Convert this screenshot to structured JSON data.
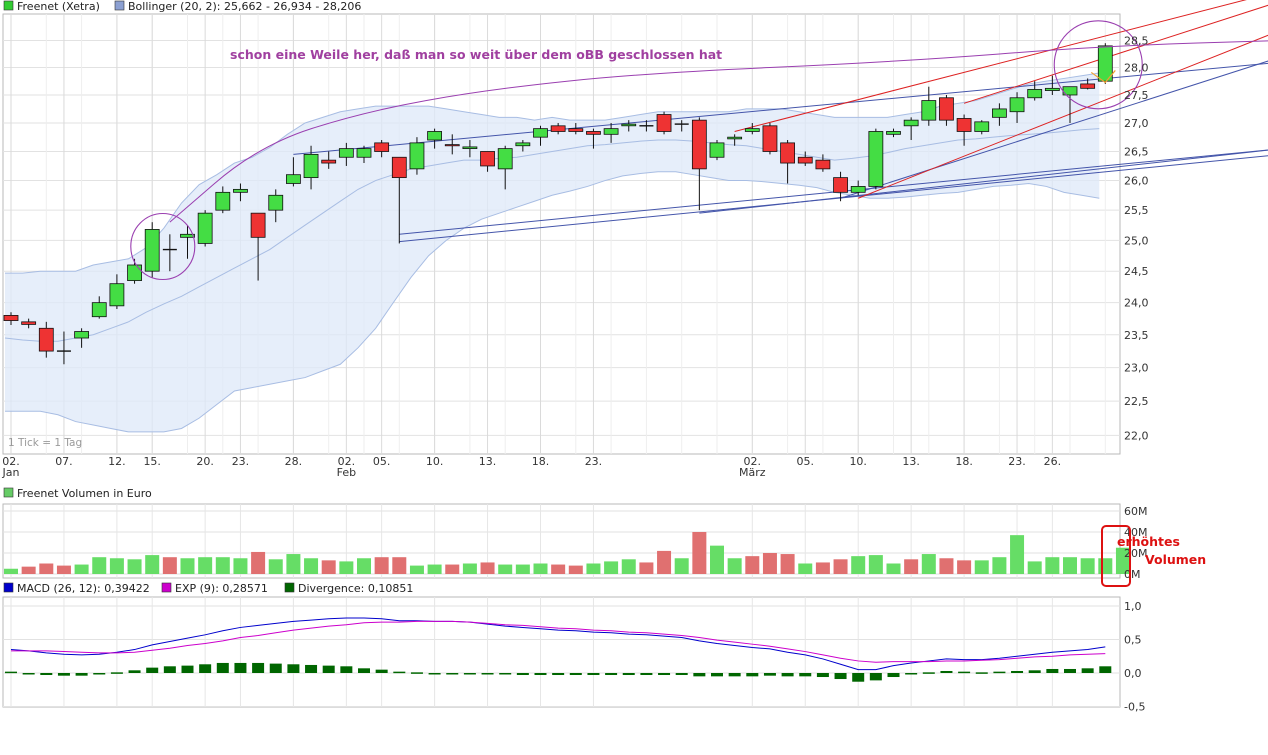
{
  "legend_main": {
    "instrument": "Freenet (Xetra)",
    "instrument_color": "#33cc33",
    "bollinger": "Bollinger (20, 2): 25,662 - 26,934 - 28,206",
    "bollinger_color": "#8ca0d2"
  },
  "tick_note": "1 Tick = 1 Tag",
  "annotations": {
    "headline": "schon eine Weile her, daß man so weit über dem oBB geschlossen hat",
    "volume_note_line1": "erhöhtes",
    "volume_note_line2": "Volumen",
    "headline_color": "#a040a0",
    "volume_note_color": "#dd1111"
  },
  "volume_legend": {
    "label": "Freenet Volumen in Euro",
    "color": "#66cc66"
  },
  "macd_legend": {
    "macd": "MACD (26, 12): 0,39422",
    "macd_color": "#0000cc",
    "exp": "EXP (9): 0,28571",
    "exp_color": "#cc00cc",
    "divergence": "Divergence: 0,10851",
    "divergence_color": "#006600"
  },
  "colors": {
    "up": "#44dd44",
    "down": "#ee3333",
    "band_fill": "#dde8f8",
    "band_line": "#a8bde3",
    "grid": "#e2e2e2"
  },
  "chart_data": [
    {
      "type": "candlestick",
      "title": "Freenet (Xetra)",
      "y_ticks": [
        "28,5",
        "28,0",
        "27,5",
        "27,0",
        "26,5",
        "26,0",
        "25,5",
        "25,0",
        "24,5",
        "24,0",
        "23,5",
        "23,0",
        "22,5",
        "22,0"
      ],
      "x_ticks": [
        "02.",
        "07.",
        "12.",
        "15.",
        "20.",
        "23.",
        "28.",
        "02.",
        "05.",
        "10.",
        "13.",
        "18.",
        "23.",
        "02.",
        "05.",
        "10.",
        "13.",
        "18.",
        "23.",
        "26."
      ],
      "x_month_labels": [
        {
          "after_tick": 0,
          "text": "Jan"
        },
        {
          "after_tick": 7,
          "text": "Feb"
        },
        {
          "after_tick": 13,
          "text": "März"
        }
      ],
      "grid": true,
      "scale": "log",
      "candles": [
        {
          "o": 23.8,
          "h": 23.85,
          "l": 23.65,
          "c": 23.72
        },
        {
          "o": 23.7,
          "h": 23.75,
          "l": 23.6,
          "c": 23.66
        },
        {
          "o": 23.6,
          "h": 23.7,
          "l": 23.15,
          "c": 23.25
        },
        {
          "o": 23.25,
          "h": 23.55,
          "l": 23.05,
          "c": 23.25
        },
        {
          "o": 23.45,
          "h": 23.6,
          "l": 23.3,
          "c": 23.55
        },
        {
          "o": 23.78,
          "h": 24.1,
          "l": 23.75,
          "c": 24.0
        },
        {
          "o": 23.95,
          "h": 24.45,
          "l": 23.9,
          "c": 24.3
        },
        {
          "o": 24.35,
          "h": 24.7,
          "l": 24.3,
          "c": 24.6
        },
        {
          "o": 24.5,
          "h": 25.3,
          "l": 24.4,
          "c": 25.18
        },
        {
          "o": 24.85,
          "h": 25.1,
          "l": 24.5,
          "c": 24.85
        },
        {
          "o": 25.05,
          "h": 25.25,
          "l": 24.7,
          "c": 25.1
        },
        {
          "o": 24.95,
          "h": 25.5,
          "l": 24.9,
          "c": 25.45
        },
        {
          "o": 25.5,
          "h": 25.9,
          "l": 25.45,
          "c": 25.8
        },
        {
          "o": 25.8,
          "h": 25.95,
          "l": 25.65,
          "c": 25.85
        },
        {
          "o": 25.45,
          "h": 25.45,
          "l": 24.35,
          "c": 25.05
        },
        {
          "o": 25.5,
          "h": 25.85,
          "l": 25.3,
          "c": 25.75
        },
        {
          "o": 25.95,
          "h": 26.4,
          "l": 25.9,
          "c": 26.1
        },
        {
          "o": 26.05,
          "h": 26.6,
          "l": 25.85,
          "c": 26.45
        },
        {
          "o": 26.35,
          "h": 26.5,
          "l": 26.2,
          "c": 26.3
        },
        {
          "o": 26.4,
          "h": 26.65,
          "l": 26.25,
          "c": 26.55
        },
        {
          "o": 26.4,
          "h": 26.6,
          "l": 26.3,
          "c": 26.55
        },
        {
          "o": 26.65,
          "h": 26.7,
          "l": 26.4,
          "c": 26.5
        },
        {
          "o": 26.4,
          "h": 26.4,
          "l": 24.95,
          "c": 26.05
        },
        {
          "o": 26.2,
          "h": 26.75,
          "l": 26.1,
          "c": 26.65
        },
        {
          "o": 26.7,
          "h": 26.9,
          "l": 26.55,
          "c": 26.85
        },
        {
          "o": 26.62,
          "h": 26.8,
          "l": 26.45,
          "c": 26.6
        },
        {
          "o": 26.55,
          "h": 26.7,
          "l": 26.4,
          "c": 26.58
        },
        {
          "o": 26.5,
          "h": 26.5,
          "l": 26.15,
          "c": 26.25
        },
        {
          "o": 26.2,
          "h": 26.6,
          "l": 25.85,
          "c": 26.55
        },
        {
          "o": 26.6,
          "h": 26.7,
          "l": 26.5,
          "c": 26.65
        },
        {
          "o": 26.75,
          "h": 26.95,
          "l": 26.6,
          "c": 26.9
        },
        {
          "o": 26.95,
          "h": 27.0,
          "l": 26.8,
          "c": 26.85
        },
        {
          "o": 26.9,
          "h": 27.0,
          "l": 26.8,
          "c": 26.85
        },
        {
          "o": 26.85,
          "h": 26.9,
          "l": 26.55,
          "c": 26.8
        },
        {
          "o": 26.8,
          "h": 27.0,
          "l": 26.65,
          "c": 26.9
        },
        {
          "o": 26.95,
          "h": 27.05,
          "l": 26.85,
          "c": 26.98
        },
        {
          "o": 26.95,
          "h": 27.05,
          "l": 26.85,
          "c": 26.95
        },
        {
          "o": 27.15,
          "h": 27.2,
          "l": 26.8,
          "c": 26.85
        },
        {
          "o": 26.98,
          "h": 27.05,
          "l": 26.85,
          "c": 26.98
        },
        {
          "o": 27.05,
          "h": 27.1,
          "l": 25.5,
          "c": 26.2
        },
        {
          "o": 26.4,
          "h": 26.7,
          "l": 26.35,
          "c": 26.65
        },
        {
          "o": 26.72,
          "h": 26.8,
          "l": 26.6,
          "c": 26.75
        },
        {
          "o": 26.85,
          "h": 27.0,
          "l": 26.8,
          "c": 26.9
        },
        {
          "o": 26.95,
          "h": 27.0,
          "l": 26.45,
          "c": 26.5
        },
        {
          "o": 26.65,
          "h": 26.7,
          "l": 25.95,
          "c": 26.3
        },
        {
          "o": 26.4,
          "h": 26.5,
          "l": 26.25,
          "c": 26.3
        },
        {
          "o": 26.35,
          "h": 26.45,
          "l": 26.15,
          "c": 26.2
        },
        {
          "o": 26.05,
          "h": 26.15,
          "l": 25.65,
          "c": 25.8
        },
        {
          "o": 25.8,
          "h": 26.0,
          "l": 25.75,
          "c": 25.9
        },
        {
          "o": 25.9,
          "h": 26.9,
          "l": 25.85,
          "c": 26.85
        },
        {
          "o": 26.8,
          "h": 26.9,
          "l": 26.75,
          "c": 26.85
        },
        {
          "o": 26.95,
          "h": 27.1,
          "l": 26.7,
          "c": 27.05
        },
        {
          "o": 27.05,
          "h": 27.65,
          "l": 26.95,
          "c": 27.4
        },
        {
          "o": 27.45,
          "h": 27.5,
          "l": 26.95,
          "c": 27.05
        },
        {
          "o": 27.08,
          "h": 27.15,
          "l": 26.6,
          "c": 26.85
        },
        {
          "o": 26.85,
          "h": 27.05,
          "l": 26.8,
          "c": 27.02
        },
        {
          "o": 27.1,
          "h": 27.35,
          "l": 26.95,
          "c": 27.25
        },
        {
          "o": 27.2,
          "h": 27.55,
          "l": 27.0,
          "c": 27.45
        },
        {
          "o": 27.45,
          "h": 27.75,
          "l": 27.4,
          "c": 27.6
        },
        {
          "o": 27.58,
          "h": 27.85,
          "l": 27.5,
          "c": 27.62
        },
        {
          "o": 27.5,
          "h": 27.6,
          "l": 27.0,
          "c": 27.65
        },
        {
          "o": 27.7,
          "h": 27.8,
          "l": 27.6,
          "c": 27.62
        },
        {
          "o": 27.75,
          "h": 28.45,
          "l": 27.7,
          "c": 28.4
        }
      ],
      "bollinger": {
        "upper": [
          24.47,
          24.47,
          24.5,
          24.5,
          24.5,
          24.6,
          24.65,
          24.7,
          24.88,
          25.2,
          25.62,
          25.93,
          26.1,
          26.3,
          26.4,
          26.57,
          26.8,
          27.0,
          27.1,
          27.2,
          27.25,
          27.3,
          27.3,
          27.3,
          27.3,
          27.25,
          27.2,
          27.15,
          27.1,
          27.1,
          27.05,
          27.1,
          27.05,
          27.05,
          27.05,
          27.1,
          27.15,
          27.2,
          27.2,
          27.2,
          27.2,
          27.2,
          27.25,
          27.25,
          27.25,
          27.2,
          27.15,
          27.1,
          27.1,
          27.1,
          27.1,
          27.15,
          27.2,
          27.3,
          27.35,
          27.4,
          27.5,
          27.6,
          27.7,
          27.75,
          27.8,
          27.85,
          27.9
        ],
        "middle": [
          23.45,
          23.42,
          23.4,
          23.4,
          23.45,
          23.5,
          23.6,
          23.7,
          23.85,
          23.98,
          24.1,
          24.25,
          24.4,
          24.55,
          24.7,
          24.85,
          25.05,
          25.25,
          25.45,
          25.65,
          25.85,
          26.0,
          26.1,
          26.2,
          26.25,
          26.3,
          26.35,
          26.35,
          26.38,
          26.4,
          26.45,
          26.5,
          26.55,
          26.6,
          26.62,
          26.65,
          26.68,
          26.7,
          26.7,
          26.68,
          26.65,
          26.62,
          26.6,
          26.55,
          26.5,
          26.45,
          26.4,
          26.35,
          26.38,
          26.42,
          26.48,
          26.55,
          26.6,
          26.65,
          26.7,
          26.72,
          26.75,
          26.78,
          26.8,
          26.82,
          26.85,
          26.88,
          26.9
        ],
        "lower": [
          22.35,
          22.35,
          22.35,
          22.3,
          22.2,
          22.15,
          22.1,
          22.05,
          22.05,
          22.05,
          22.1,
          22.25,
          22.45,
          22.65,
          22.7,
          22.75,
          22.8,
          22.85,
          22.95,
          23.05,
          23.3,
          23.6,
          24.0,
          24.4,
          24.75,
          25.0,
          25.2,
          25.35,
          25.45,
          25.55,
          25.65,
          25.75,
          25.82,
          25.9,
          26.0,
          26.08,
          26.12,
          26.15,
          26.15,
          26.1,
          26.05,
          26.0,
          26.0,
          25.98,
          25.95,
          25.92,
          25.88,
          25.8,
          25.75,
          25.7,
          25.7,
          25.72,
          25.75,
          25.78,
          25.8,
          25.85,
          25.9,
          25.92,
          25.95,
          25.9,
          25.8,
          25.75,
          25.7
        ]
      },
      "trend_lines_blue": [
        {
          "x1": 16,
          "y1": 26.45,
          "x2": 72,
          "y2": 28.1
        },
        {
          "x1": 22,
          "y1": 25.1,
          "x2": 72,
          "y2": 26.55
        },
        {
          "x1": 22,
          "y1": 24.98,
          "x2": 72,
          "y2": 26.45
        },
        {
          "x1": 39,
          "y1": 25.45,
          "x2": 72,
          "y2": 26.55
        },
        {
          "x1": 47,
          "y1": 25.7,
          "x2": 72,
          "y2": 28.2
        }
      ],
      "trend_lines_red": [
        {
          "x1": 41,
          "y1": 26.85,
          "x2": 72,
          "y2": 29.45
        },
        {
          "x1": 48,
          "y1": 25.7,
          "x2": 72,
          "y2": 28.7
        },
        {
          "x1": 54,
          "y1": 27.35,
          "x2": 72,
          "y2": 29.25
        }
      ],
      "annotation_curve": {
        "color": "#9a3fb0",
        "points": [
          [
            9,
            25.3
          ],
          [
            14,
            26.6
          ],
          [
            20,
            27.2
          ],
          [
            27,
            27.6
          ],
          [
            36,
            27.9
          ],
          [
            50,
            28.1
          ],
          [
            62,
            28.4
          ],
          [
            72,
            28.5
          ]
        ]
      },
      "circles": [
        {
          "x": 8.6,
          "y": 24.9,
          "r_x": 32,
          "r_y": 33
        },
        {
          "x": 61.6,
          "y": 28.05,
          "r_x": 44,
          "r_y": 44
        }
      ]
    },
    {
      "type": "bar",
      "title": "Freenet Volumen in Euro",
      "y_ticks": [
        "60M",
        "40M",
        "20M",
        "0M"
      ],
      "ylim": [
        0,
        60
      ],
      "values": [
        5,
        7,
        10,
        8,
        9,
        16,
        15,
        14,
        18,
        16,
        15,
        16,
        16,
        15,
        21,
        14,
        19,
        15,
        13,
        12,
        15,
        16,
        16,
        8,
        9,
        9,
        10,
        11,
        9,
        9,
        10,
        9,
        8,
        10,
        12,
        14,
        11,
        22,
        15,
        40,
        27,
        15,
        17,
        20,
        19,
        10,
        11,
        14,
        17,
        18,
        10,
        14,
        19,
        15,
        13,
        13,
        16,
        37,
        12,
        16,
        16,
        15,
        15,
        25
      ],
      "up": [
        true,
        false,
        false,
        false,
        true,
        true,
        true,
        true,
        true,
        false,
        true,
        true,
        true,
        true,
        false,
        true,
        true,
        true,
        false,
        true,
        true,
        false,
        false,
        true,
        true,
        false,
        true,
        false,
        true,
        true,
        true,
        false,
        false,
        true,
        true,
        true,
        false,
        false,
        true,
        false,
        true,
        true,
        false,
        false,
        false,
        true,
        false,
        false,
        true,
        true,
        true,
        false,
        true,
        false,
        false,
        true,
        true,
        true,
        true,
        true,
        true,
        true,
        true,
        true
      ]
    },
    {
      "type": "line+bar",
      "title": "MACD",
      "y_ticks": [
        "1,0",
        "0,5",
        "0,0",
        "-0,5"
      ],
      "ylim": [
        -0.55,
        1.05
      ],
      "series": [
        {
          "name": "MACD (26, 12)",
          "values": [
            0.35,
            0.33,
            0.3,
            0.28,
            0.27,
            0.28,
            0.31,
            0.35,
            0.42,
            0.47,
            0.52,
            0.57,
            0.63,
            0.68,
            0.71,
            0.74,
            0.77,
            0.79,
            0.81,
            0.82,
            0.82,
            0.81,
            0.78,
            0.78,
            0.77,
            0.77,
            0.76,
            0.73,
            0.7,
            0.68,
            0.66,
            0.64,
            0.63,
            0.61,
            0.6,
            0.58,
            0.57,
            0.55,
            0.53,
            0.48,
            0.44,
            0.41,
            0.38,
            0.36,
            0.31,
            0.27,
            0.21,
            0.13,
            0.05,
            0.05,
            0.11,
            0.15,
            0.18,
            0.21,
            0.2,
            0.2,
            0.22,
            0.25,
            0.28,
            0.31,
            0.33,
            0.35,
            0.39
          ]
        },
        {
          "name": "EXP (9)",
          "values": [
            0.33,
            0.33,
            0.33,
            0.32,
            0.31,
            0.3,
            0.3,
            0.31,
            0.34,
            0.37,
            0.41,
            0.44,
            0.48,
            0.53,
            0.56,
            0.6,
            0.64,
            0.67,
            0.7,
            0.72,
            0.75,
            0.76,
            0.76,
            0.77,
            0.77,
            0.77,
            0.76,
            0.74,
            0.72,
            0.71,
            0.69,
            0.67,
            0.66,
            0.64,
            0.63,
            0.61,
            0.6,
            0.58,
            0.56,
            0.53,
            0.49,
            0.46,
            0.43,
            0.4,
            0.36,
            0.32,
            0.27,
            0.22,
            0.18,
            0.16,
            0.17,
            0.17,
            0.17,
            0.18,
            0.18,
            0.19,
            0.2,
            0.22,
            0.24,
            0.25,
            0.27,
            0.28,
            0.29
          ]
        },
        {
          "name": "Divergence",
          "values": [
            0.02,
            0.0,
            -0.03,
            -0.04,
            -0.04,
            -0.02,
            0.01,
            0.04,
            0.08,
            0.1,
            0.11,
            0.13,
            0.15,
            0.15,
            0.15,
            0.14,
            0.13,
            0.12,
            0.11,
            0.1,
            0.07,
            0.05,
            0.02,
            0.01,
            0.0,
            0.0,
            0.0,
            -0.01,
            -0.02,
            -0.03,
            -0.03,
            -0.03,
            -0.03,
            -0.03,
            -0.03,
            -0.03,
            -0.03,
            -0.03,
            -0.03,
            -0.05,
            -0.05,
            -0.05,
            -0.05,
            -0.04,
            -0.05,
            -0.05,
            -0.06,
            -0.09,
            -0.13,
            -0.11,
            -0.06,
            -0.02,
            0.01,
            0.03,
            0.02,
            0.01,
            0.02,
            0.03,
            0.04,
            0.06,
            0.06,
            0.07,
            0.1
          ]
        }
      ]
    }
  ]
}
